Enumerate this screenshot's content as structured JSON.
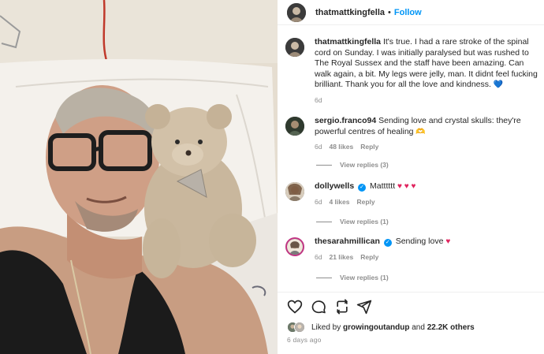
{
  "post": {
    "author": "thatmattkingfella",
    "dot": "•",
    "follow_label": "Follow"
  },
  "caption": {
    "username": "thatmattkingfella",
    "text": "It's true. I had a rare stroke of the spinal cord on Sunday. I was initially paralysed but was rushed to The Royal Sussex and the staff have been amazing. Can walk again, a bit. My legs were jelly, man. It didnt feel fucking brilliant. Thank you for all the love and kindness.",
    "emoji": "💙",
    "age": "6d"
  },
  "comments": [
    {
      "username": "sergio.franco94",
      "verified": false,
      "text": "Sending love and crystal skulls: they're powerful centres of healing",
      "emoji": "🫶",
      "age": "6d",
      "likes": "48 likes",
      "reply_label": "Reply",
      "view_replies": "View replies (3)"
    },
    {
      "username": "dollywells",
      "verified": true,
      "text": "Matttttt",
      "emoji": "♥ ♥ ♥",
      "age": "6d",
      "likes": "4 likes",
      "reply_label": "Reply",
      "view_replies": "View replies (1)"
    },
    {
      "username": "thesarahmillican",
      "verified": true,
      "text": "Sending love",
      "emoji": "♥",
      "age": "6d",
      "likes": "21 likes",
      "reply_label": "Reply",
      "view_replies": "View replies (1)"
    }
  ],
  "actions": {
    "icons": [
      "heart-icon",
      "comment-icon",
      "share-icon",
      "send-icon"
    ]
  },
  "likes_summary": {
    "prefix": "Liked by",
    "user": "growingoutandup",
    "conj": "and",
    "others": "22.2K others"
  },
  "timestamp": "6 days ago",
  "colors": {
    "link_blue": "#0095f6",
    "muted": "#8e8e8e",
    "heart_red": "#e0245e"
  }
}
